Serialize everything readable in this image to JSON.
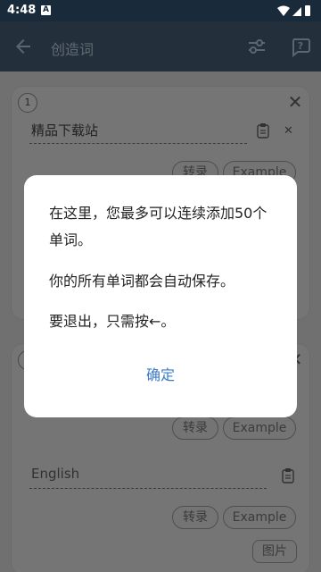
{
  "status_bar": {
    "time": "4:48",
    "notif_badge": "A"
  },
  "app_bar": {
    "title": "创造词",
    "back_icon": "arrow-back-icon",
    "filter_icon": "tune-icon",
    "help_icon": "help-icon"
  },
  "cards": [
    {
      "number": "1",
      "word": "精品下载站",
      "chips": [
        "转录",
        "Example"
      ]
    },
    {
      "number": "",
      "word_placeholder": "English",
      "chips_top": [
        "转录",
        "Example"
      ],
      "chips": [
        "转录",
        "Example"
      ],
      "image_chip": "图片"
    }
  ],
  "dialog": {
    "line1": "在这里，您最多可以连续添加50个单词。",
    "line2": "你的所有单词都会自动保存。",
    "line3": "要退出，只需按←。",
    "ok_label": "确定"
  },
  "colors": {
    "status_bar": "#192a3a",
    "app_bar": "#3d5266",
    "accent": "#3a7bc8"
  }
}
